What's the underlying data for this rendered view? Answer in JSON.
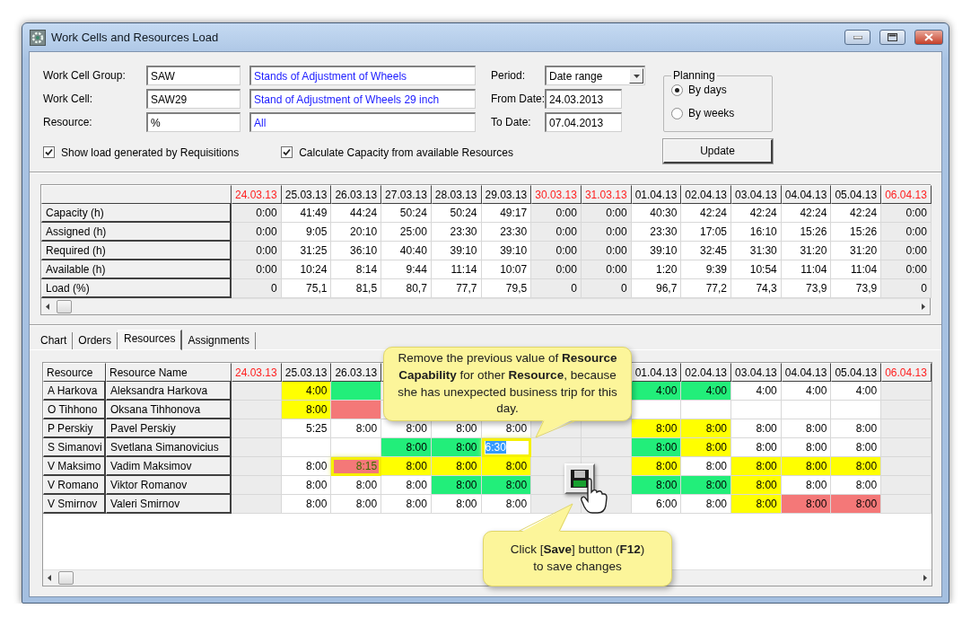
{
  "window": {
    "title": "Work Cells and Resources Load"
  },
  "filters": [
    {
      "label": "Work Cell Group:",
      "code": "SAW",
      "description": "Stands of Adjustment of Wheels"
    },
    {
      "label": "Work Cell:",
      "code": "SAW29",
      "description": "Stand of Adjustment of Wheels 29 inch"
    },
    {
      "label": "Resource:",
      "code": "%",
      "description": "All"
    }
  ],
  "options": [
    {
      "label": "Show load generated by Requisitions",
      "checked": true
    },
    {
      "label": "Calculate Capacity from available Resources",
      "checked": true
    }
  ],
  "period": {
    "label": "Period:",
    "value": "Date range"
  },
  "dates": [
    {
      "label": "From Date:",
      "value": "24.03.2013"
    },
    {
      "label": "To Date:",
      "value": "07.04.2013"
    }
  ],
  "planning": {
    "title": "Planning",
    "options": [
      {
        "label": "By days",
        "selected": true
      },
      {
        "label": "By weeks",
        "selected": false
      }
    ]
  },
  "update_button": "Update",
  "load_table": {
    "columns": [
      {
        "label": "24.03.13",
        "weekend": true
      },
      {
        "label": "25.03.13",
        "weekend": false
      },
      {
        "label": "26.03.13",
        "weekend": false
      },
      {
        "label": "27.03.13",
        "weekend": false
      },
      {
        "label": "28.03.13",
        "weekend": false
      },
      {
        "label": "29.03.13",
        "weekend": false
      },
      {
        "label": "30.03.13",
        "weekend": true
      },
      {
        "label": "31.03.13",
        "weekend": true
      },
      {
        "label": "01.04.13",
        "weekend": false
      },
      {
        "label": "02.04.13",
        "weekend": false
      },
      {
        "label": "03.04.13",
        "weekend": false
      },
      {
        "label": "04.04.13",
        "weekend": false
      },
      {
        "label": "05.04.13",
        "weekend": false
      },
      {
        "label": "06.04.13",
        "weekend": true
      }
    ],
    "rows": [
      {
        "label": "Capacity (h)",
        "values": [
          "0:00",
          "41:49",
          "44:24",
          "50:24",
          "50:24",
          "49:17",
          "0:00",
          "0:00",
          "40:30",
          "42:24",
          "42:24",
          "42:24",
          "42:24",
          "0:00"
        ]
      },
      {
        "label": "Assigned (h)",
        "values": [
          "0:00",
          "9:05",
          "20:10",
          "25:00",
          "23:30",
          "23:30",
          "0:00",
          "0:00",
          "23:30",
          "17:05",
          "16:10",
          "15:26",
          "15:26",
          "0:00"
        ]
      },
      {
        "label": "Required (h)",
        "values": [
          "0:00",
          "31:25",
          "36:10",
          "40:40",
          "39:10",
          "39:10",
          "0:00",
          "0:00",
          "39:10",
          "32:45",
          "31:30",
          "31:20",
          "31:20",
          "0:00"
        ]
      },
      {
        "label": "Available (h)",
        "values": [
          "0:00",
          "10:24",
          "8:14",
          "9:44",
          "11:14",
          "10:07",
          "0:00",
          "0:00",
          "1:20",
          "9:39",
          "10:54",
          "11:04",
          "11:04",
          "0:00"
        ]
      },
      {
        "label": "Load (%)",
        "values": [
          "0",
          "75,1",
          "81,5",
          "80,7",
          "77,7",
          "79,5",
          "0",
          "0",
          "96,7",
          "77,2",
          "74,3",
          "73,9",
          "73,9",
          "0"
        ]
      }
    ]
  },
  "tabs": [
    {
      "label": "Chart",
      "selected": false
    },
    {
      "label": "Orders",
      "selected": false
    },
    {
      "label": "Resources",
      "selected": true
    },
    {
      "label": "Assignments",
      "selected": false
    }
  ],
  "resources_table": {
    "headers": [
      "Resource",
      "Resource Name"
    ],
    "dates": [
      {
        "label": "24.03.13",
        "weekend": true
      },
      {
        "label": "25.03.13",
        "weekend": false
      },
      {
        "label": "26.03.13",
        "weekend": false
      },
      {
        "weekend": false
      },
      {
        "weekend": false
      },
      {
        "weekend": false
      },
      {
        "weekend": true
      },
      {
        "weekend": true
      },
      {
        "label": "01.04.13",
        "weekend": false
      },
      {
        "label": "02.04.13",
        "weekend": false
      },
      {
        "label": "03.04.13",
        "weekend": false
      },
      {
        "label": "04.04.13",
        "weekend": false
      },
      {
        "label": "05.04.13",
        "weekend": false
      },
      {
        "label": "06.04.13",
        "weekend": true
      }
    ],
    "rows": [
      {
        "resource": "A Harkova",
        "name": "Aleksandra Harkova",
        "cells": [
          null,
          {
            "value": "4:00",
            "color": "#ffff00"
          },
          {
            "color": "#22ee7a"
          },
          null,
          null,
          null,
          null,
          null,
          {
            "value": "4:00",
            "color": "#22ee7a"
          },
          {
            "value": "4:00",
            "color": "#22ee7a"
          },
          {
            "value": "4:00"
          },
          {
            "value": "4:00"
          },
          {
            "value": "4:00"
          },
          null
        ]
      },
      {
        "resource": "O Tihhono",
        "name": "Oksana Tihhonova",
        "cells": [
          null,
          {
            "value": "8:00",
            "color": "#ffff00"
          },
          {
            "color": "#f47878"
          },
          null,
          null,
          null,
          null,
          null,
          null,
          null,
          null,
          null,
          null,
          null
        ]
      },
      {
        "resource": "P Perskiy",
        "name": "Pavel Perskiy",
        "cells": [
          null,
          {
            "value": "5:25"
          },
          {
            "value": "8:00"
          },
          {
            "value": "8:00"
          },
          {
            "value": "8:00"
          },
          {
            "value": "8:00"
          },
          null,
          null,
          {
            "value": "8:00",
            "color": "#ffff00"
          },
          {
            "value": "8:00",
            "color": "#ffff00"
          },
          {
            "value": "8:00"
          },
          {
            "value": "8:00"
          },
          {
            "value": "8:00"
          },
          null
        ]
      },
      {
        "resource": "S Simanovi",
        "name": "Svetlana Simanovicius",
        "cells": [
          null,
          null,
          null,
          {
            "value": "8:00",
            "color": "#22ee7a"
          },
          {
            "value": "8:00",
            "color": "#22ee7a"
          },
          {
            "value": "6:30",
            "kind": "editing"
          },
          null,
          null,
          {
            "value": "8:00",
            "color": "#22ee7a"
          },
          {
            "value": "8:00",
            "color": "#ffff00"
          },
          {
            "value": "8:00"
          },
          {
            "value": "8:00"
          },
          {
            "value": "8:00"
          },
          null
        ]
      },
      {
        "resource": "V Maksimo",
        "name": "Vadim Maksimov",
        "cells": [
          null,
          {
            "value": "8:00"
          },
          {
            "value": "8:15",
            "color": "#f47878",
            "kind": "marked"
          },
          {
            "value": "8:00",
            "color": "#ffff00"
          },
          {
            "value": "8:00",
            "color": "#ffff00"
          },
          {
            "value": "8:00",
            "color": "#ffff00"
          },
          null,
          null,
          {
            "value": "8:00",
            "color": "#ffff00"
          },
          {
            "value": "8:00"
          },
          {
            "value": "8:00",
            "color": "#ffff00"
          },
          {
            "value": "8:00",
            "color": "#ffff00"
          },
          {
            "value": "8:00",
            "color": "#ffff00"
          },
          null
        ]
      },
      {
        "resource": "V Romano",
        "name": "Viktor Romanov",
        "cells": [
          null,
          {
            "value": "8:00"
          },
          {
            "value": "8:00"
          },
          {
            "value": "8:00"
          },
          {
            "value": "8:00",
            "color": "#22ee7a"
          },
          {
            "value": "8:00",
            "color": "#22ee7a"
          },
          null,
          null,
          {
            "value": "8:00",
            "color": "#22ee7a"
          },
          {
            "value": "8:00",
            "color": "#22ee7a"
          },
          {
            "value": "8:00",
            "color": "#ffff00"
          },
          {
            "value": "8:00"
          },
          {
            "value": "8:00"
          },
          null
        ]
      },
      {
        "resource": "V Smirnov",
        "name": "Valeri Smirnov",
        "cells": [
          null,
          {
            "value": "8:00"
          },
          {
            "value": "8:00"
          },
          {
            "value": "8:00"
          },
          {
            "value": "8:00"
          },
          {
            "value": "8:00"
          },
          null,
          null,
          {
            "value": "6:00"
          },
          {
            "value": "8:00"
          },
          {
            "value": "8:00",
            "color": "#ffff00"
          },
          {
            "value": "8:00",
            "color": "#f47878"
          },
          {
            "value": "8:00",
            "color": "#f47878"
          },
          null
        ]
      }
    ]
  },
  "callouts": [
    {
      "text": "Remove the previous value of **Resource Capability** for other **Resource**, because she has unexpected business trip for this day."
    },
    {
      "text": "Click [**Save**] button (**F12**) to save changes"
    }
  ]
}
